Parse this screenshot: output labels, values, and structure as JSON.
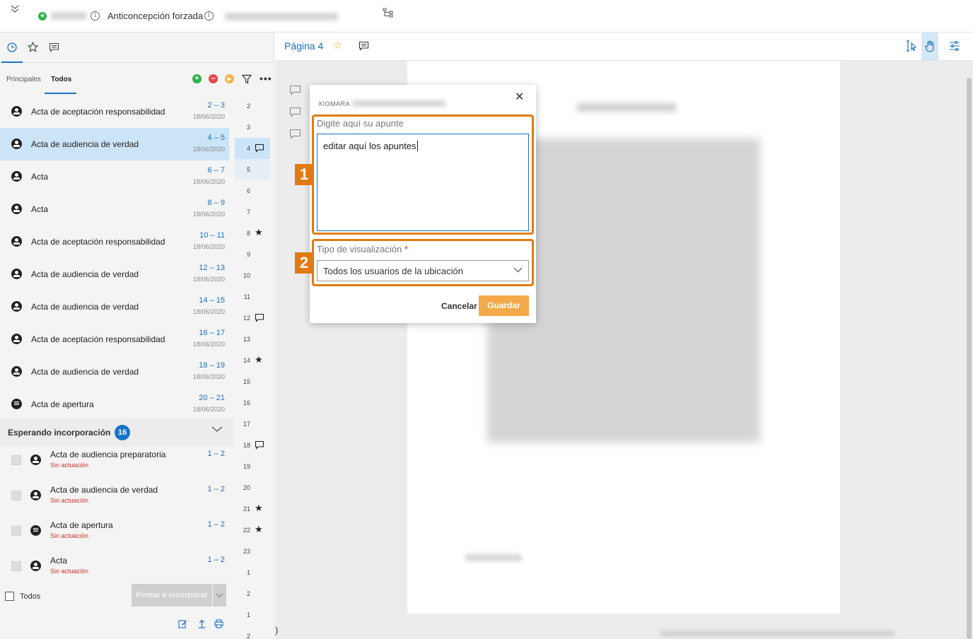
{
  "topbar": {
    "title": "Anticoncepción forzada"
  },
  "left_panel": {
    "tabs": [
      {
        "label": "Principales"
      },
      {
        "label": "Todos"
      }
    ],
    "documents": [
      {
        "name": "Acta de aceptación responsabilidad",
        "pages": "2 – 3",
        "date": "18/06/2020",
        "icon": "person-icon"
      },
      {
        "name": "Acta de audiencia de verdad",
        "pages": "4 – 5",
        "date": "18/06/2020",
        "icon": "person-icon",
        "selected": true
      },
      {
        "name": "Acta",
        "pages": "6 – 7",
        "date": "18/06/2020",
        "icon": "person-icon"
      },
      {
        "name": "Acta",
        "pages": "8 – 9",
        "date": "18/06/2020",
        "icon": "person-icon"
      },
      {
        "name": "Acta de aceptación responsabilidad",
        "pages": "10 – 11",
        "date": "18/06/2020",
        "icon": "person-icon"
      },
      {
        "name": "Acta de audiencia de verdad",
        "pages": "12 – 13",
        "date": "18/06/2020",
        "icon": "person-icon"
      },
      {
        "name": "Acta de audiencia de verdad",
        "pages": "14 – 15",
        "date": "18/06/2020",
        "icon": "person-icon"
      },
      {
        "name": "Acta de aceptación responsabilidad",
        "pages": "16 – 17",
        "date": "18/06/2020",
        "icon": "person-icon"
      },
      {
        "name": "Acta de audiencia de verdad",
        "pages": "18 – 19",
        "date": "18/06/2020",
        "icon": "person-icon"
      },
      {
        "name": "Acta de apertura",
        "pages": "20 – 21",
        "date": "18/06/2020",
        "icon": "document-icon"
      }
    ],
    "page_numbers": [
      {
        "n": "2",
        "mark": ""
      },
      {
        "n": "3",
        "mark": ""
      },
      {
        "n": "4",
        "mark": "comment"
      },
      {
        "n": "5",
        "mark": ""
      },
      {
        "n": "6",
        "mark": ""
      },
      {
        "n": "7",
        "mark": ""
      },
      {
        "n": "8",
        "mark": "star"
      },
      {
        "n": "9",
        "mark": ""
      },
      {
        "n": "10",
        "mark": ""
      },
      {
        "n": "11",
        "mark": ""
      },
      {
        "n": "12",
        "mark": "comment"
      },
      {
        "n": "13",
        "mark": ""
      },
      {
        "n": "14",
        "mark": "star"
      },
      {
        "n": "15",
        "mark": ""
      },
      {
        "n": "16",
        "mark": ""
      },
      {
        "n": "17",
        "mark": ""
      },
      {
        "n": "18",
        "mark": "comment"
      },
      {
        "n": "19",
        "mark": ""
      },
      {
        "n": "20",
        "mark": ""
      },
      {
        "n": "21",
        "mark": "star"
      },
      {
        "n": "22",
        "mark": "star"
      },
      {
        "n": "23",
        "mark": ""
      },
      {
        "n": "1",
        "mark": ""
      },
      {
        "n": "2",
        "mark": ""
      },
      {
        "n": "1",
        "mark": ""
      },
      {
        "n": "2",
        "mark": ""
      }
    ],
    "pending": {
      "label": "Esperando incorporación",
      "count": "16",
      "items": [
        {
          "name": "Acta de audiencia preparatoria",
          "status": "Sin actuación",
          "pages": "1 – 2",
          "icon": "person-icon"
        },
        {
          "name": "Acta de audiencia de verdad",
          "status": "Sin actuación",
          "pages": "1 – 2",
          "icon": "person-icon"
        },
        {
          "name": "Acta de apertura",
          "status": "Sin actuación",
          "pages": "1 – 2",
          "icon": "document-icon"
        },
        {
          "name": "Acta",
          "status": "Sin actuación",
          "pages": "1 – 2",
          "icon": "person-icon"
        }
      ]
    },
    "select_all_label": "Todos",
    "sign_button": "Firmar e incorporar"
  },
  "viewer": {
    "page_label": "Página 4"
  },
  "dialog": {
    "author": "XIOMARA",
    "note_label": "Digite aquí su apunte",
    "note_value": "editar aquí los apuntes",
    "visibility_label": "Tipo de visualización",
    "visibility_required": "*",
    "visibility_value": "Todos los usuarios de la ubicación",
    "cancel_label": "Cancelar",
    "save_label": "Guardar",
    "callout_1": "1",
    "callout_2": "2"
  },
  "colors": {
    "accent": "#1a73c8",
    "highlight": "#e07b13",
    "save_button": "#f4a94a",
    "selected_row": "#cce4f7",
    "danger": "#d0332b"
  }
}
